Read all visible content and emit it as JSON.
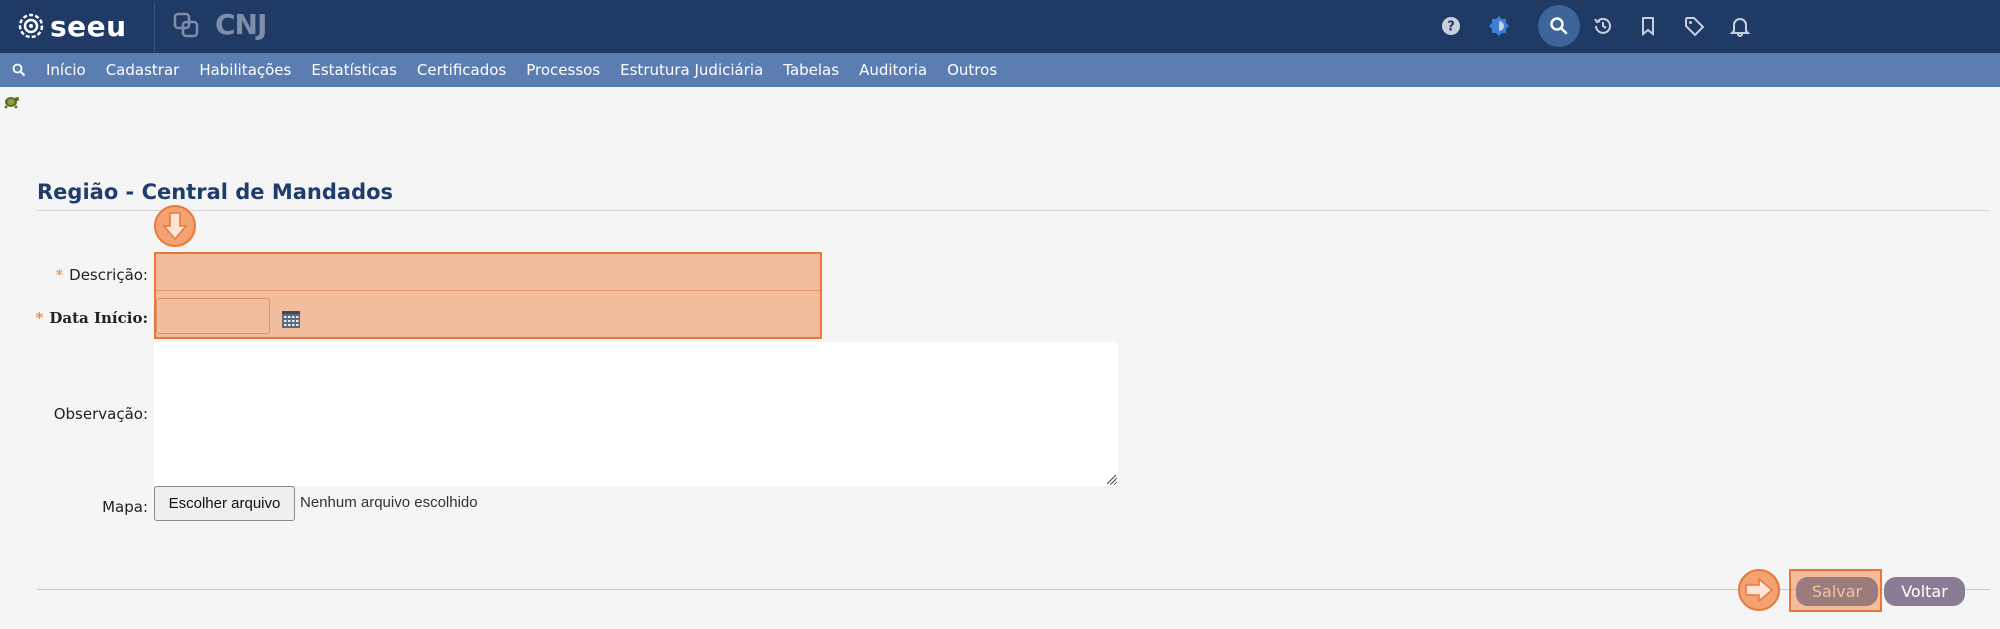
{
  "brand": {
    "logo_text": "seeu",
    "partner_text": "CNJ"
  },
  "topbar_icons": [
    "help-icon",
    "theme-toggle-icon",
    "search-icon",
    "history-icon",
    "bookmark-icon",
    "tag-icon",
    "bell-icon"
  ],
  "menu": {
    "items": [
      {
        "label": "Início"
      },
      {
        "label": "Cadastrar"
      },
      {
        "label": "Habilitações"
      },
      {
        "label": "Estatísticas"
      },
      {
        "label": "Certificados"
      },
      {
        "label": "Processos"
      },
      {
        "label": "Estrutura Judiciária"
      },
      {
        "label": "Tabelas"
      },
      {
        "label": "Auditoria"
      },
      {
        "label": "Outros"
      }
    ]
  },
  "page": {
    "title": "Região - Central de Mandados"
  },
  "form": {
    "required_mark": "*",
    "descricao_label": "Descrição:",
    "descricao_value": "",
    "data_inicio_label": "Data Início:",
    "data_inicio_value": "",
    "observacao_label": "Observação:",
    "observacao_value": "",
    "mapa_label": "Mapa:",
    "file_button_label": "Escolher arquivo",
    "file_status": "Nenhum arquivo escolhido"
  },
  "actions": {
    "save_label": "Salvar",
    "back_label": "Voltar"
  },
  "colors": {
    "topbar": "#203a66",
    "menubar": "#5b7db1",
    "title": "#1f3d6c",
    "highlight": "#f29662",
    "highlight_border": "#e8773a"
  }
}
